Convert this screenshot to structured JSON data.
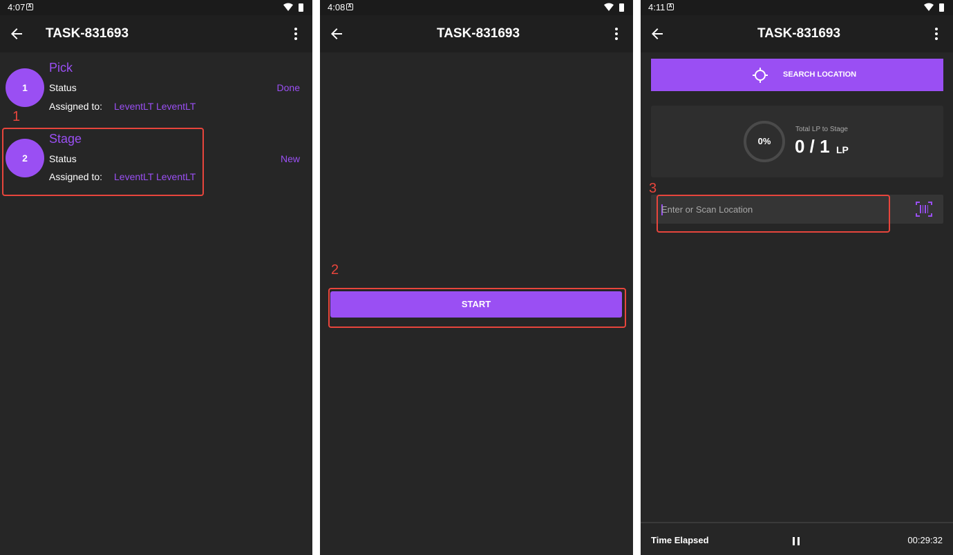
{
  "panels": [
    {
      "status_time": "4:07",
      "title": "TASK-831693",
      "annotation": "1",
      "steps": [
        {
          "number": "1",
          "name": "Pick",
          "status_label": "Status",
          "status": "Done",
          "assigned_label": "Assigned to:",
          "assignee": "LeventLT LeventLT"
        },
        {
          "number": "2",
          "name": "Stage",
          "status_label": "Status",
          "status": "New",
          "assigned_label": "Assigned to:",
          "assignee": "LeventLT LeventLT"
        }
      ]
    },
    {
      "status_time": "4:08",
      "title": "TASK-831693",
      "annotation": "2",
      "start_label": "START"
    },
    {
      "status_time": "4:11",
      "title": "TASK-831693",
      "annotation": "3",
      "search_label": "SEARCH LOCATION",
      "progress": {
        "percent_text": "0%",
        "caption": "Total LP to Stage",
        "count": "0 / 1",
        "unit": "LP"
      },
      "location_placeholder": "Enter or Scan Location",
      "footer": {
        "label": "Time Elapsed",
        "time": "00:29:32"
      }
    }
  ],
  "colors": {
    "accent": "#9a4ff3",
    "annotation": "#e8453c",
    "background": "#262626"
  }
}
